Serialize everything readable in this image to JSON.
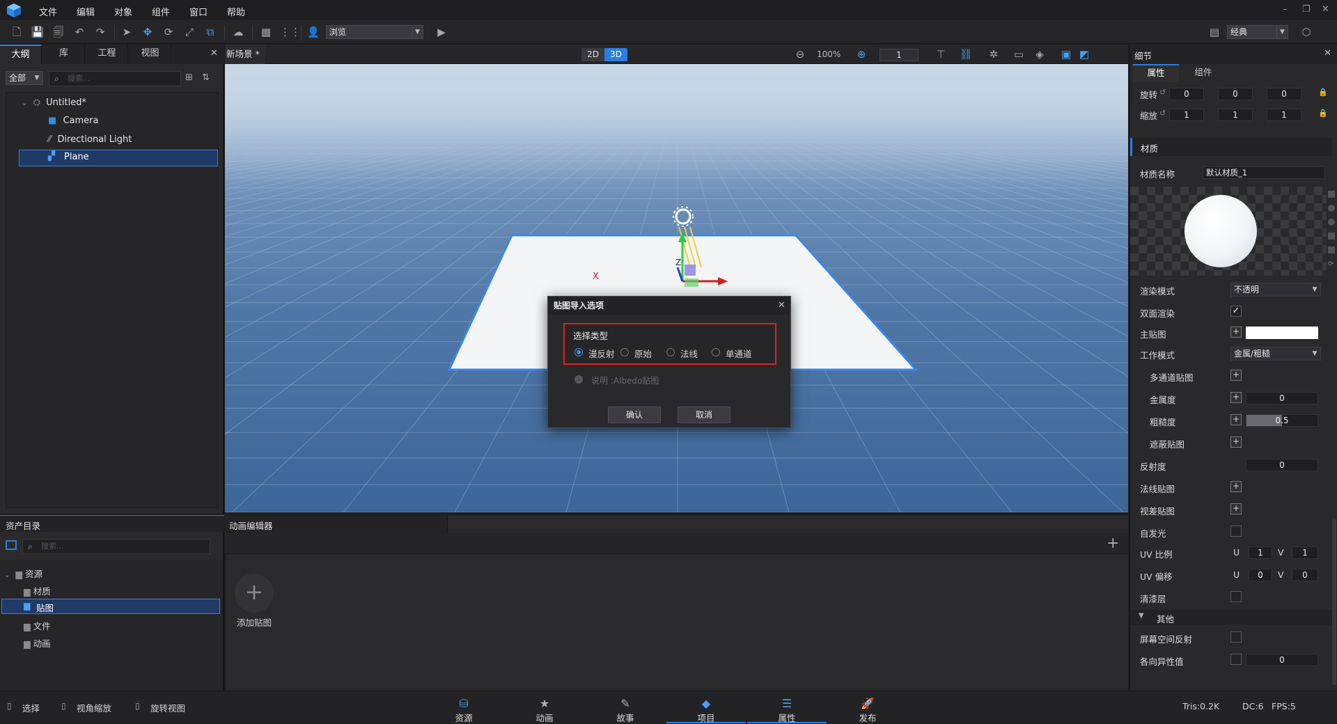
{
  "menubar": {
    "items": [
      "文件",
      "编辑",
      "对象",
      "组件",
      "窗口",
      "帮助"
    ]
  },
  "toolbar": {
    "mode_select": "浏览",
    "layout_select": "经典"
  },
  "left_panel": {
    "tabs": [
      "大纲",
      "库",
      "工程",
      "视图"
    ],
    "filter": "全部",
    "search_placeholder": "搜索...",
    "tree": [
      {
        "label": "Untitled*",
        "icon": "scene-icon"
      },
      {
        "label": "Camera",
        "icon": "camera-icon"
      },
      {
        "label": "Directional Light",
        "icon": "light-icon"
      },
      {
        "label": "Plane",
        "icon": "plane-icon",
        "selected": true
      }
    ]
  },
  "viewport": {
    "tab_title": "新场景 *",
    "mode_2d": "2D",
    "mode_3d": "3D",
    "zoom": "100%",
    "grid_value": "1",
    "gizmo_x": "X",
    "gizmo_z": "Z"
  },
  "dialog": {
    "title": "贴图导入选项",
    "group_label": "选择类型",
    "options": [
      "漫反射",
      "原始",
      "法线",
      "单通道"
    ],
    "selected_option": "漫反射",
    "note": "说明  :Albedo贴图",
    "ok": "确认",
    "cancel": "取消"
  },
  "right_panel": {
    "title": "细节",
    "tabs": [
      "属性",
      "组件"
    ],
    "rotation_label": "旋转",
    "rotation": [
      "0",
      "0",
      "0"
    ],
    "scale_label": "缩放",
    "scale": [
      "1",
      "1",
      "1"
    ],
    "material_section": "材质",
    "material_name_label": "材质名称",
    "material_name": "默认材质_1",
    "render_mode_label": "渲染模式",
    "render_mode": "不透明",
    "double_sided_label": "双面渲染",
    "main_map_label": "主贴图",
    "work_mode_label": "工作模式",
    "work_mode": "金属/粗糙",
    "multi_channel_label": "多通道贴图",
    "metallic_label": "金属度",
    "metallic": "0",
    "roughness_label": "粗糙度",
    "roughness": "0.5",
    "roughness_fill": 0.5,
    "occlusion_label": "遮蔽贴图",
    "reflectance_label": "反射度",
    "reflectance": "0",
    "normal_map_label": "法线贴图",
    "parallax_map_label": "视差贴图",
    "emission_label": "自发光",
    "uv_scale_label": "UV 比例",
    "uv_scale_u": "1",
    "uv_scale_v": "1",
    "uv_offset_label": "UV 偏移",
    "uv_offset_u": "0",
    "uv_offset_v": "0",
    "u": "U",
    "v": "V",
    "clearcoat_label": "清漆层",
    "other_section": "其他",
    "ssr_label": "屏幕空间反射",
    "aniso_label": "各向异性值",
    "aniso": "0"
  },
  "asset_panel": {
    "title": "资产目录",
    "search_placeholder": "搜索...",
    "tree": [
      "资源",
      "材质",
      "贴图",
      "文件",
      "动画"
    ],
    "selected": "贴图"
  },
  "anim_panel": {
    "title": "动画编辑器",
    "add_label": "添加贴图"
  },
  "statusbar": {
    "hints": [
      "选择",
      "视角缩放",
      "旋转视图"
    ],
    "nav": [
      {
        "label": "资源",
        "icon": "assets-icon"
      },
      {
        "label": "动画",
        "icon": "animation-icon"
      },
      {
        "label": "故事",
        "icon": "story-icon"
      },
      {
        "label": "项目",
        "icon": "project-icon"
      },
      {
        "label": "属性",
        "icon": "properties-icon"
      },
      {
        "label": "发布",
        "icon": "publish-icon"
      }
    ],
    "active_nav": [
      "项目",
      "属性"
    ],
    "tris": "Tris:0.2K",
    "dc": "DC:6",
    "fps": "FPS:5"
  },
  "colors": {
    "accent": "#2a7fe0",
    "dialog_highlight": "#e02020",
    "selection": "#1f55a8"
  }
}
